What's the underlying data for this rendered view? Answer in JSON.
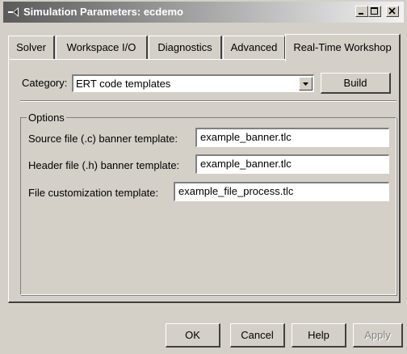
{
  "window": {
    "title": "Simulation Parameters: ecdemo"
  },
  "titlebar_buttons": {
    "minimize": "minimize-icon",
    "maximize": "maximize-icon",
    "close": "close-icon"
  },
  "tabs": [
    {
      "label": "Solver",
      "active": false
    },
    {
      "label": "Workspace I/O",
      "active": false
    },
    {
      "label": "Diagnostics",
      "active": false
    },
    {
      "label": "Advanced",
      "active": false
    },
    {
      "label": "Real-Time Workshop",
      "active": true
    }
  ],
  "category": {
    "label": "Category:",
    "value": "ERT code templates"
  },
  "build_button": "Build",
  "options": {
    "group_label": "Options",
    "rows": [
      {
        "label": "Source file (.c) banner template:",
        "value": "example_banner.tlc"
      },
      {
        "label": "Header file (.h) banner template:",
        "value": "example_banner.tlc"
      },
      {
        "label": "File customization template:",
        "value": "example_file_process.tlc"
      }
    ]
  },
  "footer": {
    "ok": "OK",
    "cancel": "Cancel",
    "help": "Help",
    "apply": "Apply"
  }
}
